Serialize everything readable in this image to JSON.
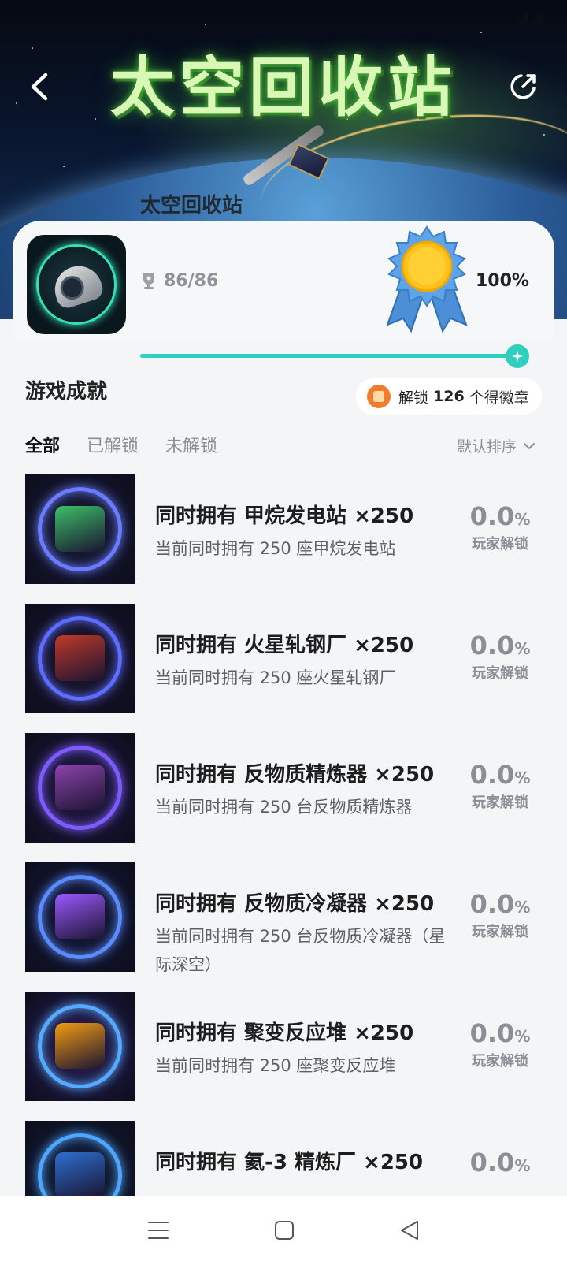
{
  "banner": {
    "title": "太空回收站",
    "subtitle": "太空回收站"
  },
  "game": {
    "trophies": "86/86",
    "percent": "100%",
    "progress": 1.0
  },
  "section": {
    "title": "游戏成就",
    "badge_prefix": "解锁",
    "badge_count": "126",
    "badge_suffix": "个得徽章"
  },
  "tabs": [
    "全部",
    "已解锁",
    "未解锁"
  ],
  "sort_label": "默认排序",
  "achievements": [
    {
      "title": "同时拥有 甲烷发电站 ×250",
      "desc": "当前同时拥有 250 座甲烷发电站",
      "rate": "0.0",
      "rate_unit": "%",
      "rate_label": "玩家解锁",
      "accent": "#6a7cff",
      "bg": "#1a1d3a",
      "core": "#3dbf6a"
    },
    {
      "title": "同时拥有 火星轧钢厂 ×250",
      "desc": "当前同时拥有 250 座火星轧钢厂",
      "rate": "0.0",
      "rate_unit": "%",
      "rate_label": "玩家解锁",
      "accent": "#5c6dff",
      "bg": "#1c1630",
      "core": "#c0392b"
    },
    {
      "title": "同时拥有 反物质精炼器 ×250",
      "desc": "当前同时拥有 250 台反物质精炼器",
      "rate": "0.0",
      "rate_unit": "%",
      "rate_label": "玩家解锁",
      "accent": "#7d5cff",
      "bg": "#231a45",
      "core": "#8e44ad"
    },
    {
      "title": "同时拥有 反物质冷凝器 ×250",
      "desc": "当前同时拥有 250 台反物质冷凝器（星际深空）",
      "rate": "0.0",
      "rate_unit": "%",
      "rate_label": "玩家解锁",
      "accent": "#5a8bff",
      "bg": "#161a3c",
      "core": "#9b59ff"
    },
    {
      "title": "同时拥有 聚变反应堆 ×250",
      "desc": "当前同时拥有 250 座聚变反应堆",
      "rate": "0.0",
      "rate_unit": "%",
      "rate_label": "玩家解锁",
      "accent": "#57a8ff",
      "bg": "#2a1f5a",
      "core": "#f39c12"
    },
    {
      "title": "同时拥有 氦-3 精炼厂 ×250",
      "desc": "",
      "rate": "0.0",
      "rate_unit": "%",
      "rate_label": "",
      "accent": "#4fa6ff",
      "bg": "#14203c",
      "core": "#2e6fd1"
    }
  ]
}
